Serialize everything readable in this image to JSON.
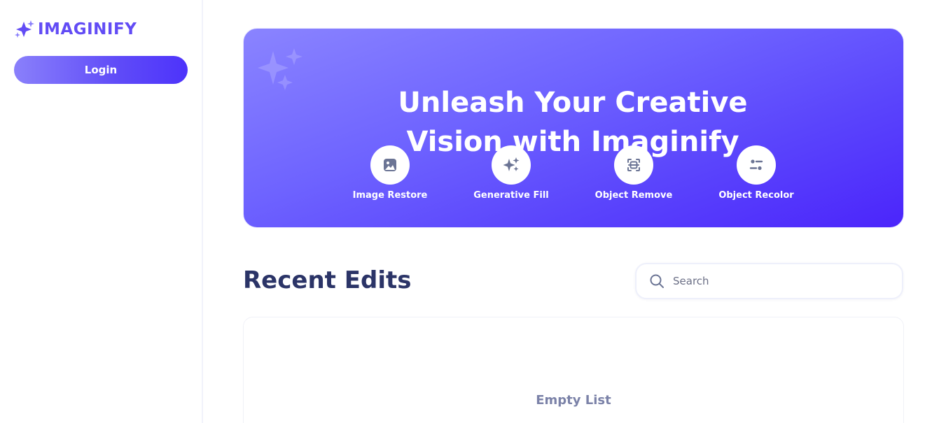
{
  "sidebar": {
    "brand": "IMAGINIFY",
    "login_label": "Login"
  },
  "banner": {
    "title": "Unleash Your Creative\nVision with Imaginify",
    "features": [
      {
        "label": "Image Restore",
        "icon": "image-icon"
      },
      {
        "label": "Generative Fill",
        "icon": "sparkles-icon"
      },
      {
        "label": "Object Remove",
        "icon": "scan-icon"
      },
      {
        "label": "Object Recolor",
        "icon": "filter-icon"
      }
    ]
  },
  "recent": {
    "title": "Recent Edits",
    "search_placeholder": "Search",
    "empty_text": "Empty List"
  },
  "colors": {
    "brand": "#624cf5",
    "heading": "#2b3467",
    "icon": "#6b7494"
  }
}
